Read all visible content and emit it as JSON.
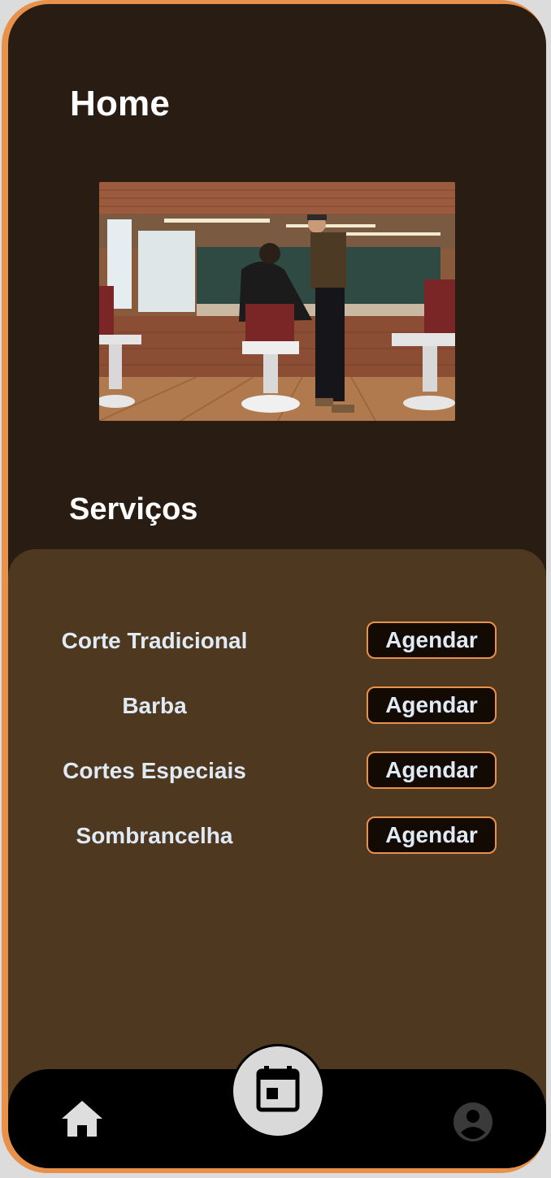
{
  "header": {
    "title": "Home"
  },
  "hero": {
    "alt": "Barbearia",
    "icon": "barbershop-photo"
  },
  "services_section": {
    "title": "Serviços"
  },
  "services": [
    {
      "name": "Corte Tradicional",
      "action": "Agendar"
    },
    {
      "name": "Barba",
      "action": "Agendar"
    },
    {
      "name": "Cortes Especiais",
      "action": "Agendar"
    },
    {
      "name": "Sombrancelha",
      "action": "Agendar"
    }
  ],
  "nav": {
    "home_icon": "home-icon",
    "calendar_icon": "calendar-icon",
    "profile_icon": "account-circle-icon"
  },
  "colors": {
    "frame": "#e8914a",
    "background": "#291d13",
    "panel": "#4e3920",
    "button_bg": "#140a04",
    "button_border": "#e8914a",
    "service_text": "#dfeaf4",
    "nav_bg": "#000000",
    "fab_bg": "#d9d9d9",
    "profile_icon": "#3a3a3a"
  }
}
